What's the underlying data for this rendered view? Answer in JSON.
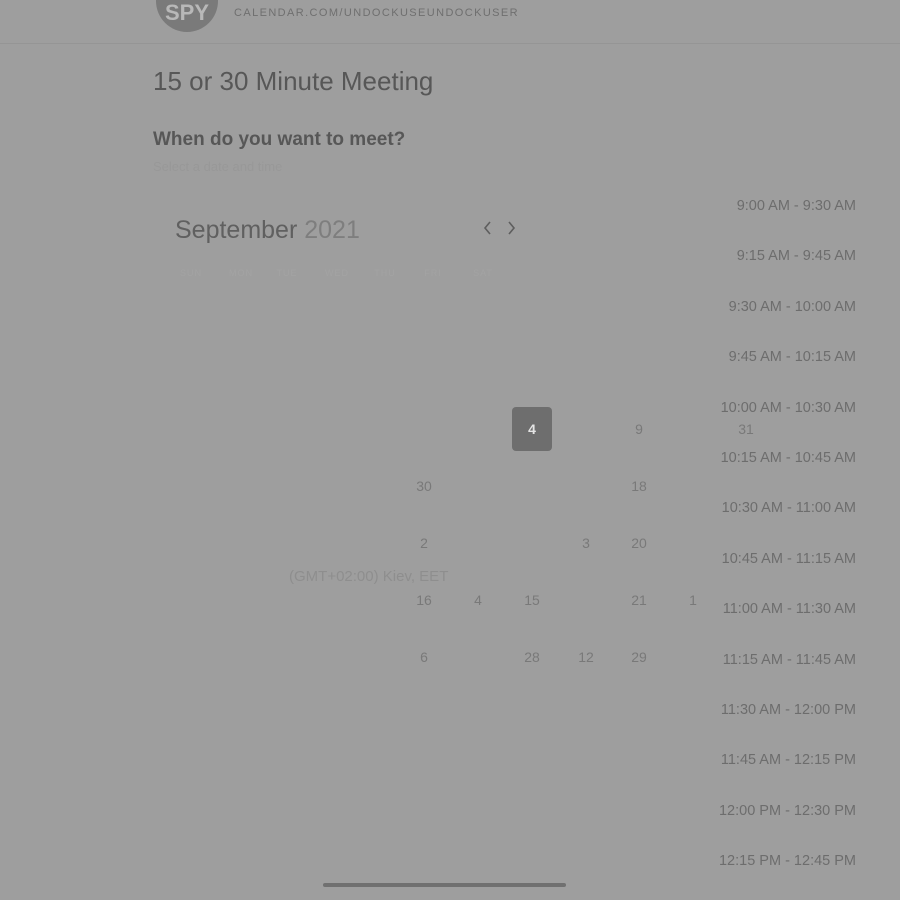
{
  "header": {
    "avatar_initials": "SPY",
    "profile_url": "CALENDAR.COM/UNDOCKUSEUNDOCKUSER"
  },
  "meeting": {
    "title": "15 or 30 Minute Meeting",
    "question": "When do you want to meet?",
    "subquestion": "Select a date and time"
  },
  "calendar": {
    "month": "September",
    "year": "2021",
    "prev_icon": "chevron-left-icon",
    "next_icon": "chevron-right-icon",
    "weekdays": [
      "SUN",
      "MON",
      "TUE",
      "WED",
      "THU",
      "FRI",
      "SAT"
    ],
    "days": [
      {
        "label": "4",
        "selected": true
      },
      {
        "label": "9"
      },
      {
        "label": "31"
      },
      {
        "label": "30"
      },
      {
        "label": "18"
      },
      {
        "label": "2"
      },
      {
        "label": "3"
      },
      {
        "label": "20"
      },
      {
        "label": "16"
      },
      {
        "label": "4"
      },
      {
        "label": "15"
      },
      {
        "label": "21"
      },
      {
        "label": "1"
      },
      {
        "label": "6"
      },
      {
        "label": "28"
      },
      {
        "label": "12"
      },
      {
        "label": "29"
      }
    ],
    "timezone": "(GMT+02:00) Kiev, EET"
  },
  "time_slots": [
    "9:00 AM - 9:30 AM",
    "9:15 AM - 9:45 AM",
    "9:30 AM - 10:00 AM",
    "9:45 AM - 10:15 AM",
    "10:00 AM - 10:30 AM",
    "10:15 AM - 10:45 AM",
    "10:30 AM - 11:00 AM",
    "10:45 AM - 11:15 AM",
    "11:00 AM - 11:30 AM",
    "11:15 AM - 11:45 AM",
    "11:30 AM - 12:00 PM",
    "11:45 AM - 12:15 PM",
    "12:00 PM - 12:30 PM",
    "12:15 PM - 12:45 PM"
  ]
}
